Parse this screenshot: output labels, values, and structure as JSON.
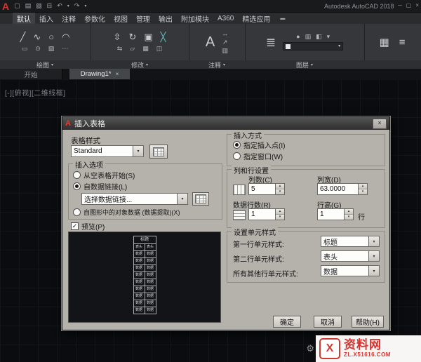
{
  "app_logo": "A",
  "titlebar": {
    "app_title": "Autodesk AutoCAD 2018"
  },
  "window_controls": {
    "minimize": "─",
    "maximize": "▢",
    "close": "×"
  },
  "icons": {
    "new": "▢",
    "open": "▤",
    "save": "▧",
    "plot": "⊟",
    "undo": "↶",
    "redo": "↷",
    "dropdown": "▾",
    "collapse": "▬",
    "line": "╱",
    "polyline": "∿",
    "circle": "○",
    "arc": "◠",
    "rectangle": "▭",
    "ellipse": "⊙",
    "hatch": "▨",
    "more": "⋯",
    "move": "⇳",
    "rotate": "↻",
    "copy": "▣",
    "trim": "╳",
    "mirror": "⇆",
    "stretch": "▱",
    "array": "▦",
    "explode": "◫",
    "text": "A",
    "dimension": "↔",
    "leader": "↗",
    "table": "▥",
    "layers": "≣",
    "bulb": "●",
    "layer_state": "▥",
    "layer_half": "◧",
    "block": "▦",
    "properties": "≡",
    "spinner_up": "▴",
    "spinner_down": "▾",
    "check": "✓",
    "close": "×",
    "gear": "⚙"
  },
  "ribbon": {
    "tabs": [
      "默认",
      "插入",
      "注释",
      "参数化",
      "视图",
      "管理",
      "输出",
      "附加模块",
      "A360",
      "精选应用"
    ],
    "panel_labels": [
      "绘图",
      "修改",
      "注释",
      "图层"
    ],
    "panel_arrow": "▾"
  },
  "file_tabs": {
    "start": "开始",
    "drawing": "Drawing1*"
  },
  "viewport_label": "[-][俯视][二维线框]",
  "dialog": {
    "title": "插入表格",
    "table_style": {
      "group_label": "表格样式",
      "value": "Standard"
    },
    "insert_options": {
      "group_label": "插入选项",
      "from_empty": "从空表格开始(S)",
      "from_data_link": "自数据链接(L)",
      "data_link_value": "选择数据链接...",
      "from_object_data": "自图形中的对象数据 (数据提取)(X)"
    },
    "preview": {
      "checkbox_label": "预览(P)",
      "table_title": "标题",
      "header_cell": "表头",
      "data_cell": "数据"
    },
    "insertion_behavior": {
      "group_label": "插入方式",
      "insertion_point": "指定插入点(I)",
      "window": "指定窗口(W)"
    },
    "column_row": {
      "group_label": "列和行设置",
      "columns_label": "列数(C)",
      "columns_value": "5",
      "col_width_label": "列宽(D)",
      "col_width_value": "63.0000",
      "data_rows_label": "数据行数(R)",
      "data_rows_value": "1",
      "row_height_label": "行高(G)",
      "row_height_value": "1",
      "row_height_unit": "行"
    },
    "cell_styles": {
      "group_label": "设置单元样式",
      "first_row_label": "第一行单元样式:",
      "first_row_value": "标题",
      "second_row_label": "第二行单元样式:",
      "second_row_value": "表头",
      "other_rows_label": "所有其他行单元样式:",
      "other_rows_value": "数据"
    },
    "buttons": {
      "ok": "确定",
      "cancel": "取消",
      "help": "帮助(H)"
    }
  },
  "watermark": {
    "logo_text": "X",
    "site_name": "资料网",
    "site_url": "ZL.X51616.COM"
  }
}
